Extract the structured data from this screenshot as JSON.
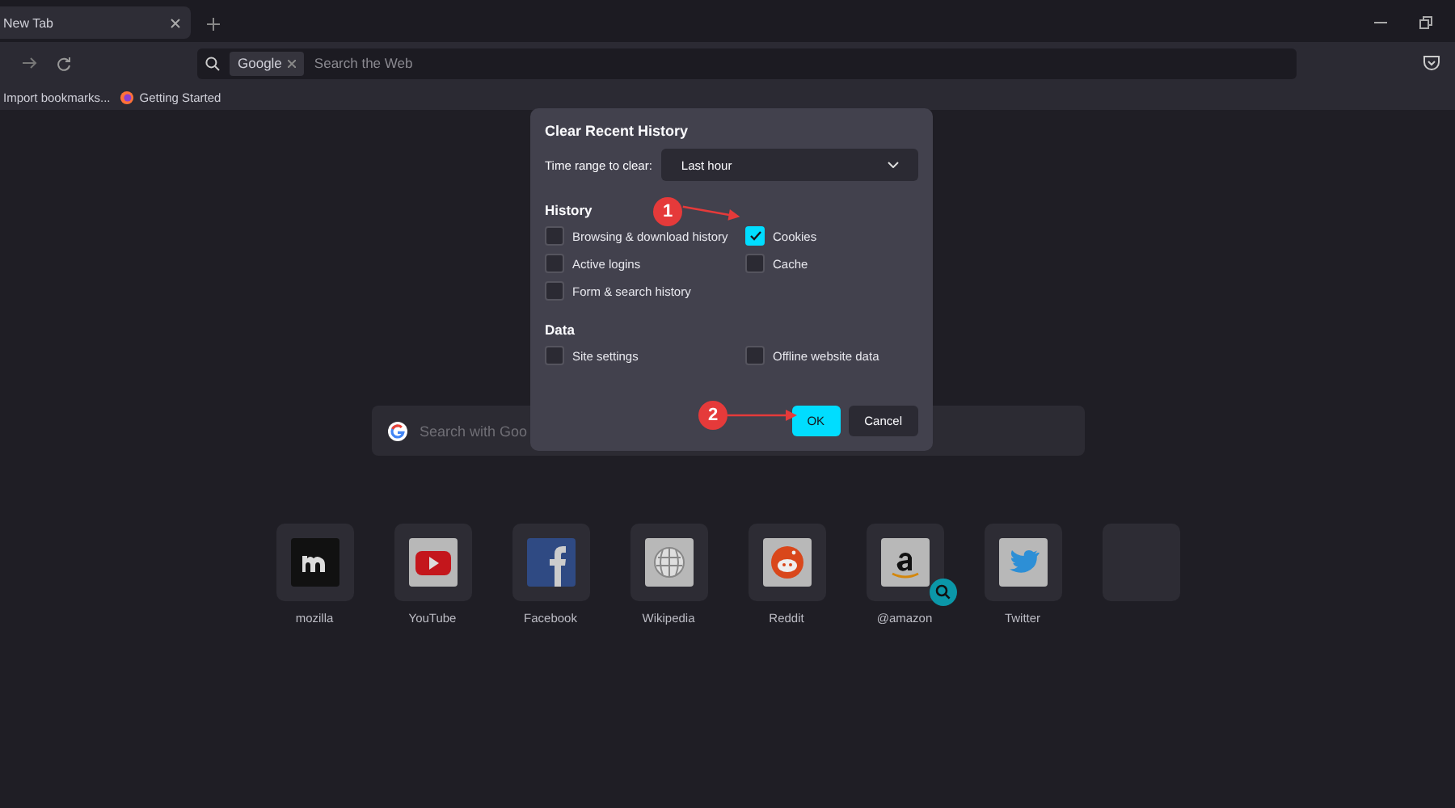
{
  "tab": {
    "title": "New Tab",
    "selected": true
  },
  "toolbar": {
    "search_engine": "Google",
    "placeholder": "Search the Web"
  },
  "bookmarks": [
    {
      "label": "Import bookmarks...",
      "kind": "plain"
    },
    {
      "label": "Getting Started",
      "kind": "firefox"
    }
  ],
  "newtab_search": {
    "placeholder": "Search with Goo"
  },
  "top_sites": [
    {
      "label": "mozilla",
      "kind": "mozilla"
    },
    {
      "label": "YouTube",
      "kind": "youtube"
    },
    {
      "label": "Facebook",
      "kind": "facebook"
    },
    {
      "label": "Wikipedia",
      "kind": "wikipedia"
    },
    {
      "label": "Reddit",
      "kind": "reddit"
    },
    {
      "label": "@amazon",
      "kind": "amazon"
    },
    {
      "label": "Twitter",
      "kind": "twitter"
    },
    {
      "kind": "empty"
    }
  ],
  "dialog": {
    "title": "Clear Recent History",
    "time_range_label": "Time range to clear:",
    "time_range_value": "Last hour",
    "sections": [
      {
        "heading": "History",
        "options": [
          {
            "label": "Browsing & download history",
            "checked": false
          },
          {
            "label": "Cookies",
            "checked": true
          },
          {
            "label": "Active logins",
            "checked": false
          },
          {
            "label": "Cache",
            "checked": false
          },
          {
            "label": "Form & search history",
            "checked": false
          }
        ]
      },
      {
        "heading": "Data",
        "options": [
          {
            "label": "Site settings",
            "checked": false
          },
          {
            "label": "Offline website data",
            "checked": false
          }
        ]
      }
    ],
    "buttons": [
      {
        "label": "OK",
        "kind": "primary"
      },
      {
        "label": "Cancel",
        "kind": "secondary"
      }
    ],
    "annotations": [
      {
        "number": "1"
      },
      {
        "number": "2"
      }
    ]
  }
}
